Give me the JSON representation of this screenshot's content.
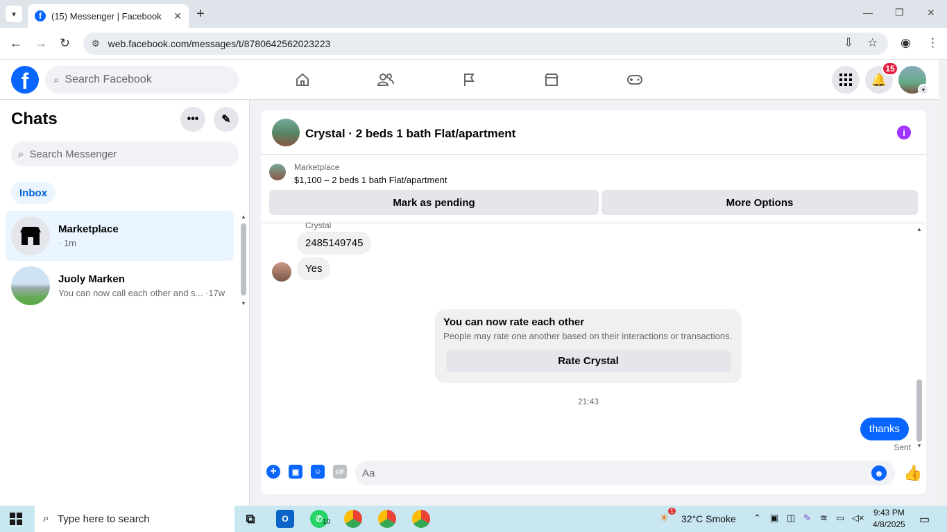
{
  "browser": {
    "tab_title": "(15) Messenger | Facebook",
    "url": "web.facebook.com/messages/t/8780642562023223"
  },
  "fb": {
    "search_placeholder": "Search Facebook",
    "notification_count": "15"
  },
  "chats": {
    "title": "Chats",
    "search_placeholder": "Search Messenger",
    "filter": "Inbox",
    "items": [
      {
        "name": "Marketplace",
        "subtitle": "· 1m"
      },
      {
        "name": "Juoly Marken",
        "subtitle": "You can now call each other and s... ·17w"
      }
    ]
  },
  "conversation": {
    "title": "Crystal · 2 beds 1 bath Flat/apartment",
    "listing_label": "Marketplace",
    "listing_price": "$1,100 – 2 beds 1 bath Flat/apartment",
    "mark_pending": "Mark as pending",
    "more_options": "More Options",
    "sender": "Crystal",
    "messages_in": [
      "2485149745",
      "Yes"
    ],
    "rate_title": "You can now rate each other",
    "rate_desc": "People may rate one another based on their interactions or transactions.",
    "rate_button": "Rate Crystal",
    "timestamp": "21:43",
    "message_out": "thanks",
    "status": "Sent",
    "composer_placeholder": "Aa",
    "gif_label": "GIF"
  },
  "taskbar": {
    "search_placeholder": "Type here to search",
    "weather": "32°C  Smoke",
    "whatsapp_count": "10",
    "weather_alert": "1",
    "time": "9:43 PM",
    "date": "4/8/2025"
  },
  "colors": {
    "fb_blue": "#0866ff",
    "badge_red": "#e41e3f",
    "info_purple": "#a033ff"
  }
}
